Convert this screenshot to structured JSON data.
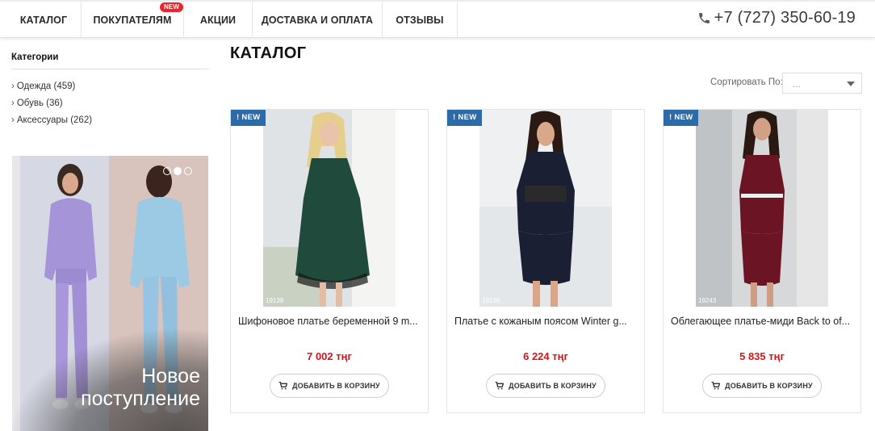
{
  "nav": {
    "items": [
      {
        "label": "КАТАЛОГ"
      },
      {
        "label": "ПОКУПАТЕЛЯМ",
        "badge": "NEW"
      },
      {
        "label": "АКЦИИ"
      },
      {
        "label": "ДОСТАВКА И ОПЛАТА"
      },
      {
        "label": "ОТЗЫВЫ"
      }
    ],
    "phone": "+7 (727) 350-60-19",
    "badge_color": "#e8262e"
  },
  "sidebar": {
    "title": "Категории",
    "categories": [
      {
        "label": "Одежда (459)"
      },
      {
        "label": "Обувь (36)"
      },
      {
        "label": "Аксессуары (262)"
      }
    ],
    "banner": {
      "line1": "Новое",
      "line2": "поступление",
      "slides": 3,
      "active_slide": 2
    }
  },
  "main": {
    "title": "КАТАЛОГ",
    "sort": {
      "label": "Сортировать По:",
      "value": "..."
    },
    "products": [
      {
        "tag": "NEW",
        "sku": "19139",
        "name": "Шифоновое платье беременной 9 m...",
        "price": "7 002 тңг",
        "button": "ДОБАВИТЬ В КОРЗИНУ",
        "dress_color": "#1f4a3c"
      },
      {
        "tag": "NEW",
        "sku": "19136",
        "name": "Платье с кожаным поясом Winter g...",
        "price": "6 224 тңг",
        "button": "ДОБАВИТЬ В КОРЗИНУ",
        "dress_color": "#1b1f33"
      },
      {
        "tag": "NEW",
        "sku": "19243",
        "name": "Облегающее платье-миди Back to of...",
        "price": "5 835 тңг",
        "button": "ДОБАВИТЬ В КОРЗИНУ",
        "dress_color": "#6b1524"
      }
    ],
    "tag_color": "#2d6aa8",
    "price_color": "#d2161e"
  }
}
